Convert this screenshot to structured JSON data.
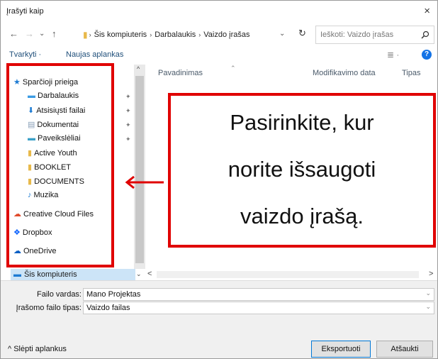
{
  "window": {
    "title": "Įrašyti kaip",
    "close": "×"
  },
  "nav": {
    "back": "←",
    "forward": "→",
    "recent": "⌄",
    "up": "↑",
    "breadcrumbs": [
      "Šis kompiuteris",
      "Darbalaukis",
      "Vaizdo įrašas"
    ],
    "separator": "›",
    "refresh": "↻",
    "search_placeholder": "Ieškoti: Vaizdo įrašas"
  },
  "toolbar": {
    "organize": "Tvarkyti ·",
    "new_folder": "Naujas aplankas",
    "view_icon": "≣ ·",
    "help": "?"
  },
  "sidebar": {
    "items": [
      {
        "label": "Sparčioji prieiga",
        "icon": "star-icon",
        "glyph": "★",
        "color": "#1d7bd3",
        "pinned": false
      },
      {
        "label": "Darbalaukis",
        "icon": "desktop-folder-icon",
        "glyph": "▬",
        "color": "#3b9be3",
        "pinned": true
      },
      {
        "label": "Atsisiųsti failai",
        "icon": "download-folder-icon",
        "glyph": "⬇",
        "color": "#1d7bd3",
        "pinned": true
      },
      {
        "label": "Dokumentai",
        "icon": "documents-folder-icon",
        "glyph": "▤",
        "color": "#8aa0b8",
        "pinned": true
      },
      {
        "label": "Paveikslėliai",
        "icon": "pictures-folder-icon",
        "glyph": "▬",
        "color": "#3aa0c8",
        "pinned": true
      },
      {
        "label": "Active Youth",
        "icon": "folder-icon",
        "glyph": "▮",
        "color": "#e8b94a",
        "pinned": false
      },
      {
        "label": "BOOKLET",
        "icon": "folder-icon",
        "glyph": "▮",
        "color": "#e8b94a",
        "pinned": false
      },
      {
        "label": "DOCUMENTS",
        "icon": "folder-icon",
        "glyph": "▮",
        "color": "#e8b94a",
        "pinned": false
      },
      {
        "label": "Muzika",
        "icon": "music-folder-icon",
        "glyph": "♪",
        "color": "#1d7bd3",
        "pinned": false
      },
      {
        "label": "Creative Cloud Files",
        "icon": "creative-cloud-icon",
        "glyph": "☁",
        "color": "#e04a2a",
        "pinned": false
      },
      {
        "label": "Dropbox",
        "icon": "dropbox-icon",
        "glyph": "❖",
        "color": "#0a61fe",
        "pinned": false
      },
      {
        "label": "OneDrive",
        "icon": "onedrive-icon",
        "glyph": "☁",
        "color": "#0a5fc4",
        "pinned": false
      }
    ],
    "this_pc": "Šis kompiuteris",
    "pin_glyph": "✦"
  },
  "filelist": {
    "columns": [
      "Pavadinimas",
      "Modifikavimo data",
      "Tipas"
    ],
    "sort_glyph": "⌃"
  },
  "callout": {
    "lines": [
      "Pasirinkite, kur",
      "norite išsaugoti",
      "vaizdo įrašą."
    ],
    "border_color": "#e00000"
  },
  "form": {
    "filename_label": "Failo vardas:",
    "filename_value": "Mano Projektas",
    "filetype_label": "Įrašomo failo tipas:",
    "filetype_value": "Vaizdo failas",
    "dropdown_glyph": "⌄"
  },
  "footer": {
    "hide_folders": "^ Slėpti aplankus",
    "export": "Eksportuoti",
    "cancel": "Atšaukti"
  },
  "scroll": {
    "up": "^",
    "down": "⌄",
    "left": "<",
    "right": ">"
  }
}
